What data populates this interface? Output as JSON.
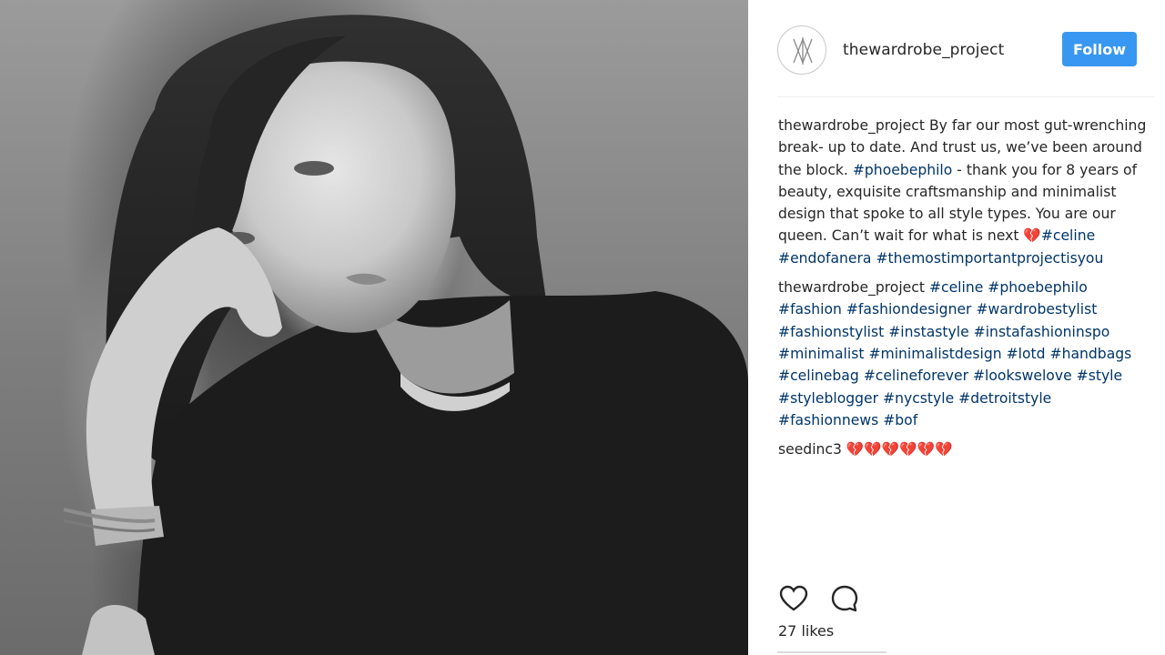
{
  "post": {
    "author": "thewardrobe_project",
    "follow_label": "Follow",
    "likes": "27 likes"
  },
  "caption": {
    "user": "thewardrobe_project",
    "segments": [
      {
        "t": "By far our most gut-wrenching break- up to date. And trust us, we’ve been around the block. ",
        "tag": false
      },
      {
        "t": "#phoebephilo",
        "tag": true
      },
      {
        "t": " - thank you for 8 years of beauty, exquisite craftsmanship and minimalist design that spoke to all style types. You are our queen. Can’t wait for what is next 💔",
        "tag": false
      },
      {
        "t": "#celine",
        "tag": true
      },
      {
        "t": " ",
        "tag": false
      },
      {
        "t": "#endofanera",
        "tag": true
      },
      {
        "t": " ",
        "tag": false
      },
      {
        "t": "#themostimportantprojectisyou",
        "tag": true
      }
    ]
  },
  "comments": [
    {
      "user": "thewardrobe_project",
      "tags": [
        "#celine",
        "#phoebephilo",
        "#fashion",
        "#fashiondesigner",
        "#wardrobestylist",
        "#fashionstylist",
        "#instastyle",
        "#instafashioninspo",
        "#minimalist",
        "#minimalistdesign",
        "#lotd",
        "#handbags",
        "#celinebag",
        "#celineforever",
        "#lookswelove",
        "#style",
        "#styleblogger",
        "#nycstyle",
        "#detroitstyle",
        "#fashionnews",
        "#bof"
      ]
    },
    {
      "user": "seedinc3",
      "text": "💔💔💔💔💔💔"
    }
  ],
  "icons": {
    "like": "heart-outline-icon",
    "comment": "comment-bubble-icon",
    "avatar": "wardrobe-monogram-logo"
  },
  "colors": {
    "follow_button": "#3897f0",
    "hashtag": "#003569",
    "text": "#262626"
  }
}
